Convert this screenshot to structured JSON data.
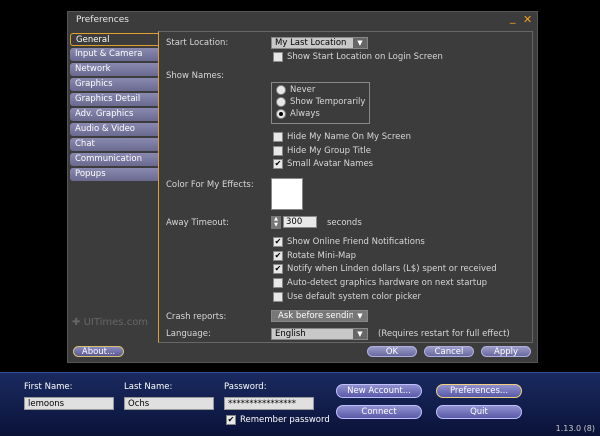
{
  "window": {
    "title": "Preferences",
    "minimize_glyph": "_",
    "close_glyph": "✕"
  },
  "tabs": [
    {
      "label": "General"
    },
    {
      "label": "Input & Camera"
    },
    {
      "label": "Network"
    },
    {
      "label": "Graphics"
    },
    {
      "label": "Graphics Detail"
    },
    {
      "label": "Adv. Graphics"
    },
    {
      "label": "Audio & Video"
    },
    {
      "label": "Chat"
    },
    {
      "label": "Communication"
    },
    {
      "label": "Popups"
    }
  ],
  "general": {
    "start_location_label": "Start Location:",
    "start_location_value": "My Last Location",
    "show_start_location": "Show Start Location on Login Screen",
    "show_names_label": "Show Names:",
    "radio_never": "Never",
    "radio_temp": "Show Temporarily",
    "radio_always": "Always",
    "hide_name": "Hide My Name On My Screen",
    "hide_group": "Hide My Group Title",
    "small_avatar": "Small Avatar Names",
    "color_effects_label": "Color For My Effects:",
    "away_label": "Away Timeout:",
    "away_value": "300",
    "away_unit": "seconds",
    "friend_notif": "Show Online Friend Notifications",
    "rotate_map": "Rotate Mini-Map",
    "notify_linden": "Notify when Linden dollars (L$) spent or received",
    "autodetect": "Auto-detect graphics hardware on next startup",
    "default_color": "Use default system color picker",
    "crash_label": "Crash reports:",
    "crash_value": "Ask before sending",
    "language_label": "Language:",
    "language_value": "English",
    "language_note": "(Requires restart for full effect)"
  },
  "buttons": {
    "about": "About...",
    "ok": "OK",
    "cancel": "Cancel",
    "apply": "Apply"
  },
  "watermark": "UITimes.com",
  "login": {
    "first_name_label": "First Name:",
    "first_name_value": "lemoons",
    "last_name_label": "Last Name:",
    "last_name_value": "Ochs",
    "password_label": "Password:",
    "password_value": "****************",
    "remember_label": "Remember password",
    "new_account": "New Account...",
    "preferences": "Preferences...",
    "connect": "Connect",
    "quit": "Quit",
    "version": "1.13.0 (8)"
  },
  "colors": {
    "accent": "#e0a030",
    "window_bg": "#3c3c3c",
    "tab": "#7a7aa0",
    "login_bar": "#14215a"
  }
}
